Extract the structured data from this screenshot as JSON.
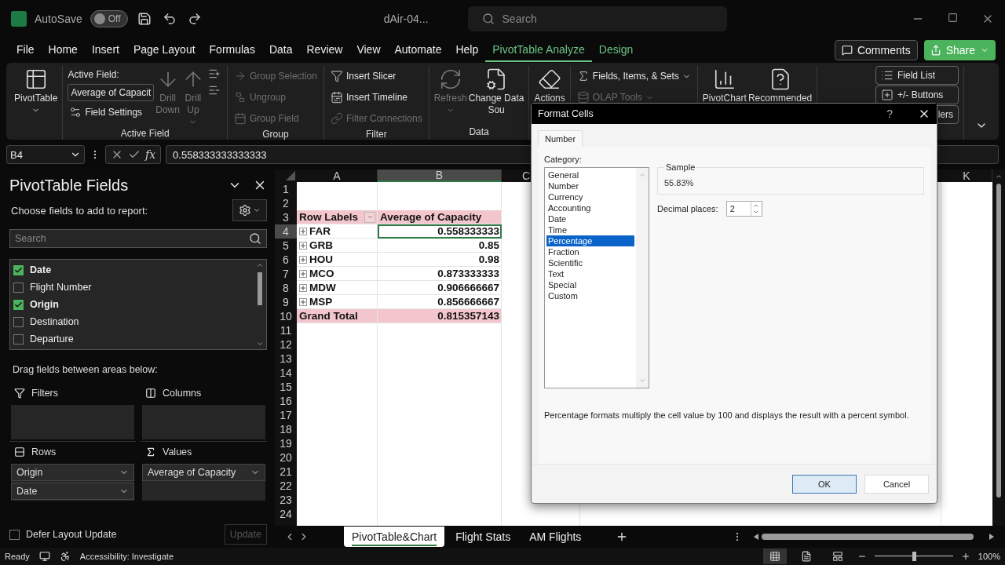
{
  "title_bar": {
    "autosave": {
      "label": "AutoSave",
      "state": "Off",
      "on": false
    },
    "file_name": "dAir-04...",
    "search": {
      "placeholder": "Search"
    }
  },
  "menu": [
    {
      "label": "File",
      "selected": false,
      "contextual": false
    },
    {
      "label": "Home",
      "selected": false,
      "contextual": false
    },
    {
      "label": "Insert",
      "selected": false,
      "contextual": false
    },
    {
      "label": "Page Layout",
      "selected": false,
      "contextual": false
    },
    {
      "label": "Formulas",
      "selected": false,
      "contextual": false
    },
    {
      "label": "Data",
      "selected": false,
      "contextual": false
    },
    {
      "label": "Review",
      "selected": false,
      "contextual": false
    },
    {
      "label": "View",
      "selected": false,
      "contextual": false
    },
    {
      "label": "Automate",
      "selected": false,
      "contextual": false
    },
    {
      "label": "Help",
      "selected": false,
      "contextual": false
    },
    {
      "label": "PivotTable Analyze",
      "selected": true,
      "contextual": true
    },
    {
      "label": "Design",
      "selected": false,
      "contextual": true
    }
  ],
  "comments": "Comments",
  "share": "Share",
  "ribbon": {
    "groups": [
      {
        "columns": [
          [
            {
              "kind": "large",
              "label": "PivotTable",
              "dropdown": true,
              "disabled": false
            }
          ]
        ]
      },
      {
        "label": "Active Field",
        "columns": [
          [
            {
              "kind": "heading",
              "label": "Active Field:"
            },
            {
              "kind": "field",
              "value": "Average of Capacit"
            },
            {
              "kind": "small",
              "label": "Field Settings",
              "disabled": false
            }
          ],
          [
            {
              "kind": "large",
              "label": "Drill\nDown",
              "dropdown": false,
              "disabled": true
            }
          ],
          [
            {
              "kind": "large",
              "label": "Drill\nUp",
              "dropdown": true,
              "disabled": true
            }
          ],
          [
            {
              "kind": "icon",
              "disabled": false
            },
            {
              "kind": "icon",
              "disabled": false
            }
          ]
        ]
      },
      {
        "label": "Group",
        "columns": [
          [
            {
              "kind": "small",
              "label": "Group Selection",
              "disabled": true
            },
            {
              "kind": "small",
              "label": "Ungroup",
              "disabled": true
            },
            {
              "kind": "small",
              "label": "Group Field",
              "disabled": true
            }
          ]
        ]
      },
      {
        "label": "Filter",
        "columns": [
          [
            {
              "kind": "small",
              "label": "Insert Slicer",
              "disabled": false
            },
            {
              "kind": "small",
              "label": "Insert Timeline",
              "disabled": false
            },
            {
              "kind": "small",
              "label": "Filter Connections",
              "disabled": true
            }
          ]
        ]
      },
      {
        "label": "Data",
        "columns": [
          [
            {
              "kind": "large",
              "label": "Refresh",
              "dropdown": true,
              "disabled": true
            }
          ],
          [
            {
              "kind": "large",
              "label": "Change Data\nSou",
              "dropdown": false,
              "disabled": false
            }
          ]
        ]
      },
      {
        "columns": [
          [
            {
              "kind": "large",
              "label": "Actions",
              "dropdown": false,
              "disabled": false
            }
          ]
        ]
      },
      {
        "columns": [
          [
            {
              "kind": "small",
              "label": "Fields, Items, & Sets",
              "dropdown": true,
              "disabled": false
            },
            {
              "kind": "small",
              "label": "OLAP Tools",
              "dropdown": true,
              "disabled": true
            }
          ]
        ]
      },
      {
        "columns": [
          [
            {
              "kind": "large",
              "label": "PivotChart",
              "dropdown": false,
              "disabled": false
            }
          ],
          [
            {
              "kind": "large",
              "label": "Recommended",
              "dropdown": false,
              "disabled": false
            }
          ]
        ]
      },
      {
        "columns": [
          [
            {
              "kind": "toggle",
              "label": "Field List",
              "on": true
            },
            {
              "kind": "toggle",
              "label": "+/- Buttons",
              "on": true
            },
            {
              "kind": "toggle",
              "label": "lers",
              "on": true
            }
          ]
        ]
      }
    ]
  },
  "formula_bar": {
    "name_box": "B4",
    "fx": "fx",
    "value": "0.558333333333333"
  },
  "pivot_pane": {
    "title": "PivotTable Fields",
    "subtitle": "Choose fields to add to report:",
    "search": {
      "placeholder": "Search"
    },
    "fields": [
      {
        "label": "Date",
        "checked": true
      },
      {
        "label": "Flight Number",
        "checked": false
      },
      {
        "label": "Origin",
        "checked": true
      },
      {
        "label": "Destination",
        "checked": false
      },
      {
        "label": "Departure",
        "checked": false
      }
    ],
    "areas_hint": "Drag fields between areas below:",
    "areas": [
      {
        "label": "Filters"
      },
      {
        "label": "Columns"
      },
      {
        "label": "Rows",
        "items": [
          "Origin",
          "Date"
        ]
      },
      {
        "label": "Values",
        "items": [
          "Average of Capacity"
        ]
      }
    ],
    "defer": {
      "label": "Defer Layout Update",
      "checked": false
    },
    "update": {
      "label": "Update",
      "disabled": true
    }
  },
  "sheet": {
    "columns": [
      {
        "label": "A",
        "selected": false
      },
      {
        "label": "B",
        "selected": true
      },
      {
        "label": "C",
        "selected": false
      },
      {
        "label": "K",
        "selected": false
      }
    ],
    "row_numbers": [
      "1",
      "2",
      "3",
      "4",
      "5",
      "6",
      "7",
      "8",
      "9",
      "10",
      "11",
      "12",
      "13",
      "14",
      "15",
      "16",
      "17",
      "18",
      "19",
      "20",
      "21",
      "22",
      "23",
      "24"
    ],
    "pivot": [
      {
        "kind": "header",
        "label": "Row Labels",
        "value": "Average of Capacity"
      },
      {
        "kind": "item",
        "label": "FAR",
        "value": "0.558333333",
        "selected": true
      },
      {
        "kind": "item",
        "label": "GRB",
        "value": "0.85",
        "selected": false
      },
      {
        "kind": "item",
        "label": "HOU",
        "value": "0.98",
        "selected": false
      },
      {
        "kind": "item",
        "label": "MCO",
        "value": "0.873333333",
        "selected": false
      },
      {
        "kind": "item",
        "label": "MDW",
        "value": "0.906666667",
        "selected": false
      },
      {
        "kind": "item",
        "label": "MSP",
        "value": "0.856666667",
        "selected": false
      },
      {
        "kind": "total",
        "label": "Grand Total",
        "value": "0.815357143"
      }
    ],
    "tabs": [
      {
        "label": "PivotTable&Chart",
        "selected": true
      },
      {
        "label": "Flight Stats",
        "selected": false
      },
      {
        "label": "AM Flights",
        "selected": false
      }
    ]
  },
  "status_bar": {
    "ready": "Ready",
    "accessibility": "Accessibility: Investigate",
    "views": [
      {
        "selected": true
      },
      {
        "selected": false
      },
      {
        "selected": false
      }
    ],
    "zoom": {
      "level": 0.5,
      "reading": "100%"
    }
  },
  "dialog": {
    "title": "Format Cells",
    "help": "?",
    "tabs": [
      {
        "label": "Number",
        "selected": true
      }
    ],
    "category_label": "Category:",
    "categories": [
      {
        "label": "General",
        "selected": false
      },
      {
        "label": "Number",
        "selected": false
      },
      {
        "label": "Currency",
        "selected": false
      },
      {
        "label": "Accounting",
        "selected": false
      },
      {
        "label": "Date",
        "selected": false
      },
      {
        "label": "Time",
        "selected": false
      },
      {
        "label": "Percentage",
        "selected": true
      },
      {
        "label": "Fraction",
        "selected": false
      },
      {
        "label": "Scientific",
        "selected": false
      },
      {
        "label": "Text",
        "selected": false
      },
      {
        "label": "Special",
        "selected": false
      },
      {
        "label": "Custom",
        "selected": false
      }
    ],
    "sample_label": "Sample",
    "sample_value": "55.83%",
    "decimal_label": "Decimal places:",
    "decimal_value": "2",
    "description": "Percentage formats multiply the cell value by 100 and displays the result with a percent symbol.",
    "buttons": [
      {
        "label": "OK",
        "default": true
      },
      {
        "label": "Cancel",
        "default": false
      }
    ]
  }
}
